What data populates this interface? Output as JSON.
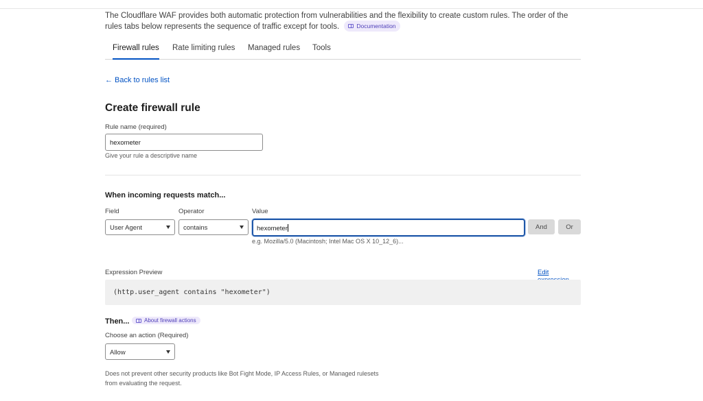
{
  "intro": {
    "text": "The Cloudflare WAF provides both automatic protection from vulnerabilities and the flexibility to create custom rules. The order of the rules tabs below represents the sequence of traffic except for tools.",
    "doc_link": "Documentation"
  },
  "tabs": [
    {
      "label": "Firewall rules",
      "active": true
    },
    {
      "label": "Rate limiting rules",
      "active": false
    },
    {
      "label": "Managed rules",
      "active": false
    },
    {
      "label": "Tools",
      "active": false
    }
  ],
  "back_link": "Back to rules list",
  "title": "Create firewall rule",
  "rule_name": {
    "label": "Rule name (required)",
    "value": "hexometer",
    "hint": "Give your rule a descriptive name"
  },
  "match": {
    "heading": "When incoming requests match...",
    "field_label": "Field",
    "field_value": "User Agent",
    "operator_label": "Operator",
    "operator_value": "contains",
    "value_label": "Value",
    "value": "hexometer",
    "value_hint": "e.g. Mozilla/5.0 (Macintosh; Intel Mac OS X 10_12_6)...",
    "and_label": "And",
    "or_label": "Or"
  },
  "expression": {
    "label": "Expression Preview",
    "edit_link": "Edit expression",
    "code": "(http.user_agent contains \"hexometer\")"
  },
  "then": {
    "heading": "Then...",
    "about_link": "About firewall actions",
    "action_label": "Choose an action (Required)",
    "action_value": "Allow",
    "note": "Does not prevent other security products like Bot Fight Mode, IP Access Rules, or Managed rulesets from evaluating the request."
  },
  "colors": {
    "link": "#0051c3",
    "active_tab": "#0051c3",
    "badge_bg": "#eee9fb",
    "focus_border": "#1f57a8"
  }
}
